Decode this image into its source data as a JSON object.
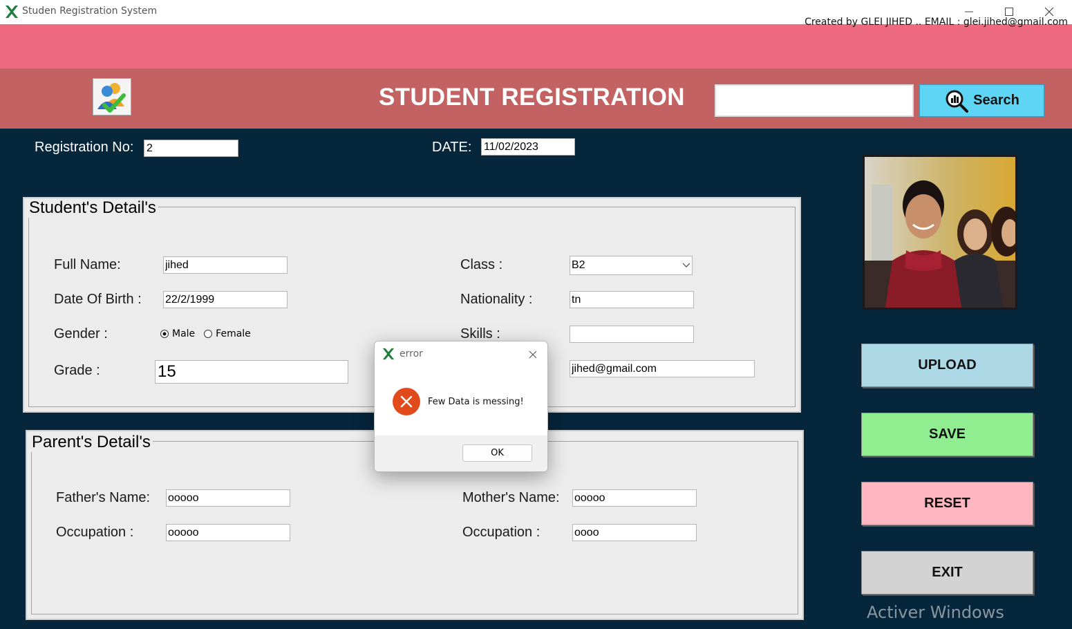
{
  "window": {
    "title": "Studen Registration System",
    "minimize_icon": "minimize-icon",
    "maximize_icon": "maximize-icon",
    "close_icon": "close-icon"
  },
  "credit": "Created by GLEI JIHED .. EMAIL : glei.jihed@gmail.com",
  "header": {
    "title": "STUDENT REGISTRATION",
    "search_value": "",
    "search_label": "Search"
  },
  "registration": {
    "label": "Registration No:",
    "value": "2"
  },
  "date": {
    "label": "DATE:",
    "value": "11/02/2023"
  },
  "student": {
    "title": "Student's Detail's",
    "full_name_label": "Full Name:",
    "full_name": "jihed",
    "dob_label": "Date Of Birth :",
    "dob": "22/2/1999",
    "gender_label": "Gender :",
    "gender_male": "Male",
    "gender_female": "Female",
    "gender_selected": "Male",
    "grade_label": "Grade :",
    "grade": "15",
    "class_label": "Class :",
    "class": "B2",
    "nationality_label": "Nationality :",
    "nationality": "tn",
    "skills_label": "Skills :",
    "skills": "",
    "email": "jihed@gmail.com"
  },
  "parent": {
    "title": "Parent's Detail's",
    "father_label": "Father's Name:",
    "father": "ooooo",
    "father_occ_label": "Occupation :",
    "father_occ": "ooooo",
    "mother_label": "Mother's Name:",
    "mother": "ooooo",
    "mother_occ_label": "Occupation :",
    "mother_occ": "oooo"
  },
  "buttons": {
    "upload": "UPLOAD",
    "save": "SAVE",
    "reset": "RESET",
    "exit": "EXIT"
  },
  "colors": {
    "upload": "#add8e6",
    "save": "#90ee90",
    "reset": "#ffb6c1",
    "exit": "#d3d3d3"
  },
  "dialog": {
    "title": "error",
    "message": "Few Data is messing!",
    "ok": "OK"
  },
  "watermark": "Activer Windows"
}
